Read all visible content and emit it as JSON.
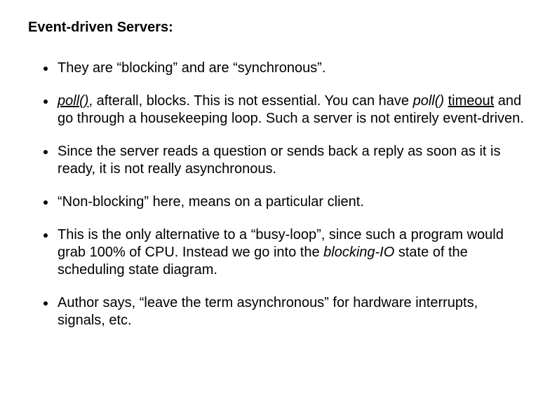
{
  "title": "Event-driven Servers:",
  "bullets": {
    "b0": {
      "t0": "They are “blocking” and are “synchronous”."
    },
    "b1": {
      "t0": "poll()",
      "t1": ", afterall, blocks. This is not essential. You can have ",
      "t2": "poll()",
      "t3": " ",
      "t4": "timeout",
      "t5": " and go through a housekeeping loop. Such a server is not entirely event-driven."
    },
    "b2": {
      "t0": "Since the server reads a question or sends back a reply as soon as it is ready, it is not really asynchronous."
    },
    "b3": {
      "t0": "“Non-blocking” here, means on a particular client."
    },
    "b4": {
      "t0": "This is the only alternative to a “busy-loop”, since such a program would grab 100% of CPU. Instead we go into the ",
      "t1": "blocking-IO",
      "t2": " state of the scheduling state diagram."
    },
    "b5": {
      "t0": "Author says, “leave the term asynchronous” for hardware interrupts, signals, etc."
    }
  }
}
